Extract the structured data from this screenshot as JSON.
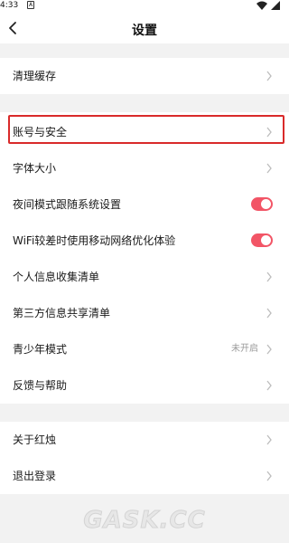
{
  "status_bar": {
    "time": "4:33",
    "notification_icon": "A",
    "icons": [
      "wifi-icon",
      "signal-icon"
    ]
  },
  "header": {
    "title": "设置",
    "back_icon": "chevron-left-icon"
  },
  "groups": [
    {
      "items": [
        {
          "label": "清理缓存",
          "type": "link"
        }
      ]
    },
    {
      "items": [
        {
          "label": "账号与安全",
          "type": "link",
          "highlighted": true
        },
        {
          "label": "字体大小",
          "type": "link"
        },
        {
          "label": "夜间模式跟随系统设置",
          "type": "toggle",
          "on": true
        },
        {
          "label": "WiFi较差时使用移动网络优化体验",
          "type": "toggle",
          "on": true
        },
        {
          "label": "个人信息收集清单",
          "type": "link"
        },
        {
          "label": "第三方信息共享清单",
          "type": "link"
        },
        {
          "label": "青少年模式",
          "type": "link",
          "value": "未开启"
        },
        {
          "label": "反馈与帮助",
          "type": "link"
        }
      ]
    },
    {
      "items": [
        {
          "label": "关于红烛",
          "type": "link"
        },
        {
          "label": "退出登录",
          "type": "link"
        }
      ]
    }
  ],
  "colors": {
    "toggle_on": "#f25566",
    "highlight_border": "#d92a2a",
    "background": "#f2f2f2"
  },
  "watermark": "GASK.CC"
}
